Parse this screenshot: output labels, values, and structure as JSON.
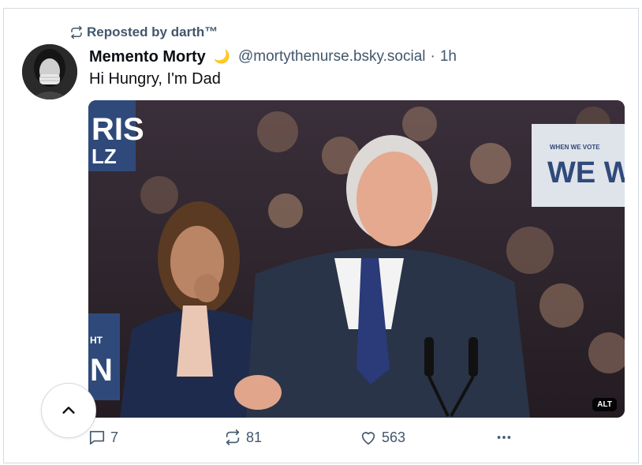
{
  "repost": {
    "label": "Reposted by darth™"
  },
  "author": {
    "display_name": "Memento Morty",
    "emoji": "🌙",
    "handle": "@mortythenurse.bsky.social",
    "separator": "·",
    "time": "1h"
  },
  "post": {
    "text": "Hi Hungry, I'm Dad"
  },
  "media": {
    "alt_badge": "ALT",
    "sign_left_top": "RIS",
    "sign_left_sub": "LZ",
    "sign_right_small": "WHEN WE VOTE",
    "sign_right_big": "WE WI",
    "sign_left_bottom_a": "HT",
    "sign_left_bottom_b": "N"
  },
  "actions": {
    "reply_count": "7",
    "repost_count": "81",
    "like_count": "563"
  },
  "colors": {
    "muted": "#42576c",
    "border": "#d4dbe2"
  }
}
